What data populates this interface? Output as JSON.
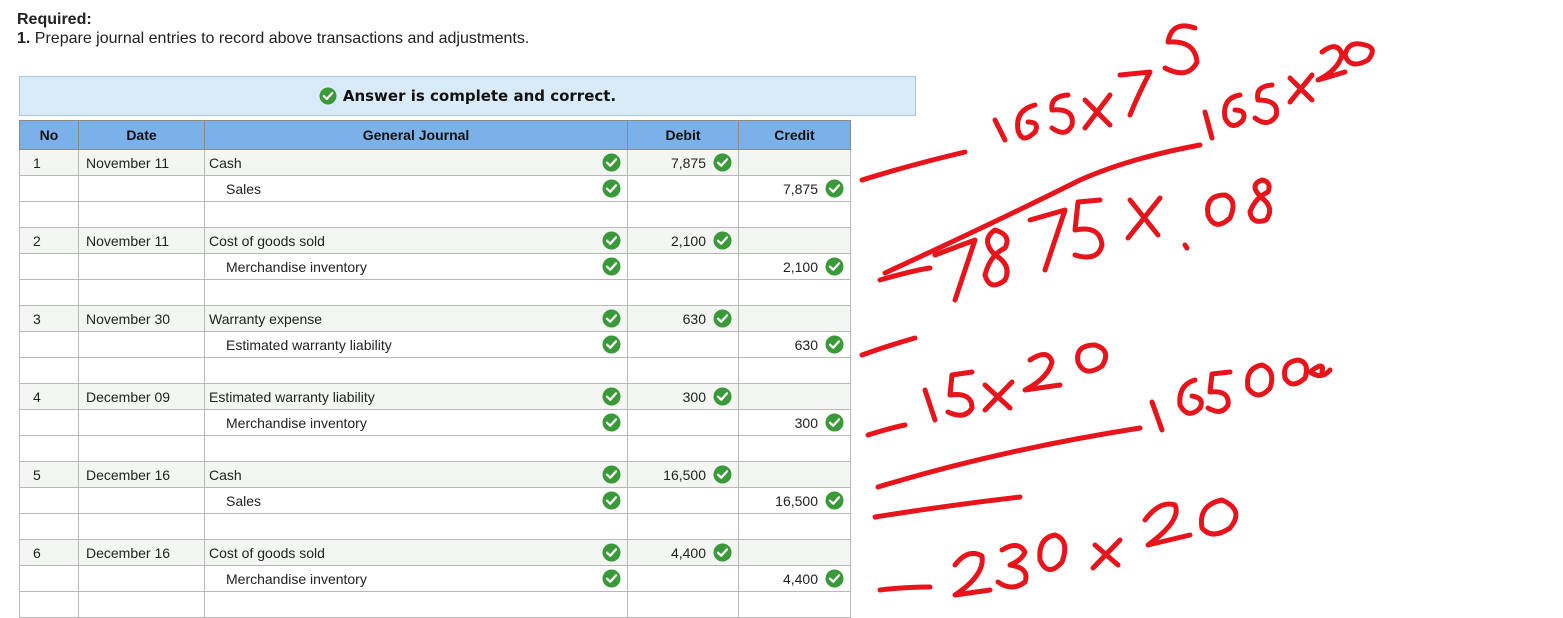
{
  "required": {
    "title": "Required:",
    "step_number": "1.",
    "step_text": "Prepare journal entries to record above transactions and adjustments."
  },
  "banner": {
    "text": "Answer is complete and correct."
  },
  "table": {
    "headers": {
      "no": "No",
      "date": "Date",
      "journal": "General Journal",
      "debit": "Debit",
      "credit": "Credit"
    },
    "rows": [
      {
        "no": "1",
        "date": "November 11",
        "account": "Cash",
        "debit": "7,875",
        "credit": "",
        "indent": false
      },
      {
        "no": "",
        "date": "",
        "account": "Sales",
        "debit": "",
        "credit": "7,875",
        "indent": true
      },
      {
        "no": "2",
        "date": "November 11",
        "account": "Cost of goods sold",
        "debit": "2,100",
        "credit": "",
        "indent": false
      },
      {
        "no": "",
        "date": "",
        "account": "Merchandise inventory",
        "debit": "",
        "credit": "2,100",
        "indent": true
      },
      {
        "no": "3",
        "date": "November 30",
        "account": "Warranty expense",
        "debit": "630",
        "credit": "",
        "indent": false
      },
      {
        "no": "",
        "date": "",
        "account": "Estimated warranty liability",
        "debit": "",
        "credit": "630",
        "indent": true
      },
      {
        "no": "4",
        "date": "December 09",
        "account": "Estimated warranty liability",
        "debit": "300",
        "credit": "",
        "indent": false
      },
      {
        "no": "",
        "date": "",
        "account": "Merchandise inventory",
        "debit": "",
        "credit": "300",
        "indent": true
      },
      {
        "no": "5",
        "date": "December 16",
        "account": "Cash",
        "debit": "16,500",
        "credit": "",
        "indent": false
      },
      {
        "no": "",
        "date": "",
        "account": "Sales",
        "debit": "",
        "credit": "16,500",
        "indent": true
      },
      {
        "no": "6",
        "date": "December 16",
        "account": "Cost of goods sold",
        "debit": "4,400",
        "credit": "",
        "indent": false
      },
      {
        "no": "",
        "date": "",
        "account": "Merchandise inventory",
        "debit": "",
        "credit": "4,400",
        "indent": true
      }
    ]
  },
  "handwriting": {
    "notes": [
      "165x75",
      "165x20",
      "7875x.08",
      "15x20",
      "16500",
      "230 x 20"
    ],
    "color": "#e8141b"
  },
  "colors": {
    "check_green": "#3a9a3a",
    "header_blue": "#7bb0e8",
    "banner_bg": "#d9ebf9"
  },
  "icons": {
    "check": "check-circle-icon"
  }
}
